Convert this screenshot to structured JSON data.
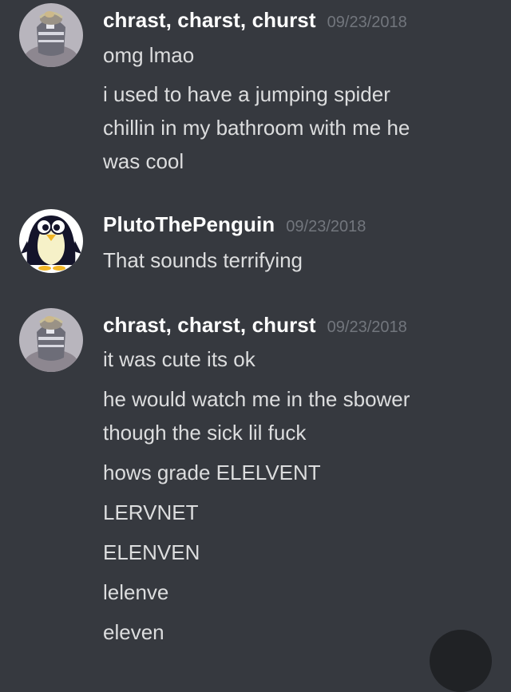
{
  "messages": [
    {
      "author": "chrast, charst, churst",
      "timestamp": "09/23/2018",
      "avatar_icon": "knit-beanie-avatar",
      "lines": [
        "omg lmao",
        "i used to have a jumping spider",
        "chillin in my bathroom with me he",
        "was cool"
      ]
    },
    {
      "author": "PlutoThePenguin",
      "timestamp": "09/23/2018",
      "avatar_icon": "cartoon-penguin-avatar",
      "lines": [
        "That sounds terrifying"
      ]
    },
    {
      "author": "chrast, charst, churst",
      "timestamp": "09/23/2018",
      "avatar_icon": "knit-beanie-avatar",
      "lines": [
        "it was cute its ok",
        "he would watch me in the sbower",
        "though the sick lil fuck",
        "hows grade ELELVENT",
        "LERVNET",
        "ELENVEN",
        "lelenve",
        "eleven"
      ]
    }
  ],
  "colors": {
    "background": "#36393f",
    "username": "#ffffff",
    "timestamp": "#72767d",
    "message_text": "#dcddde"
  }
}
